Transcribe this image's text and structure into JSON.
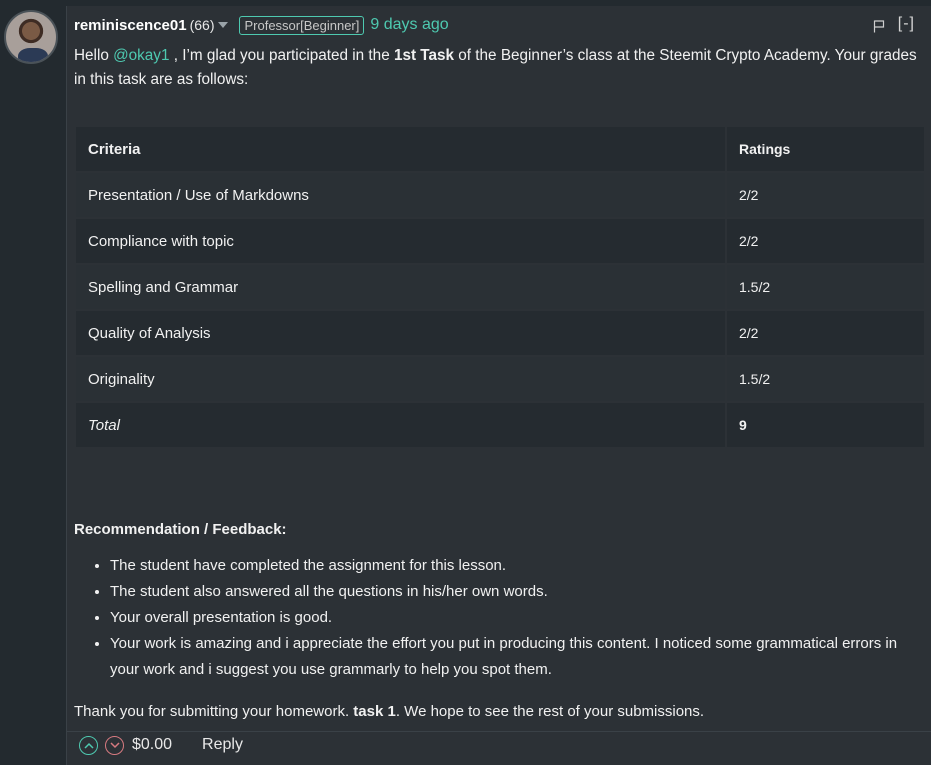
{
  "comment": {
    "author": "reminiscence01",
    "reputation": "(66)",
    "badge": "Professor[Beginner]",
    "timestamp": "9 days ago",
    "collapse_label": "[-]",
    "intro": {
      "part1": "Hello ",
      "mention": "@okay1",
      "part2": " , I’m glad you participated in the ",
      "bold1": "1st Task",
      "part3": " of the Beginner’s class at the Steemit Crypto Academy. Your grades in this task are as follows:"
    },
    "table": {
      "headers": [
        "Criteria",
        "Ratings"
      ],
      "rows": [
        {
          "criteria": "Presentation / Use of Markdowns",
          "rating": "2/2"
        },
        {
          "criteria": "Compliance with topic",
          "rating": "2/2"
        },
        {
          "criteria": "Spelling and Grammar",
          "rating": "1.5/2"
        },
        {
          "criteria": "Quality of Analysis",
          "rating": "2/2"
        },
        {
          "criteria": "Originality",
          "rating": "1.5/2"
        }
      ],
      "total_label": "Total",
      "total_value": "9"
    },
    "feedback_title": "Recommendation / Feedback:",
    "feedback_items": [
      "The student have completed the assignment for this lesson.",
      "The student also answered all the questions in his/her own words.",
      "Your overall presentation is good.",
      "Your work is amazing and i appreciate the effort you put in producing this content. I noticed some grammatical errors in your work and i suggest you use grammarly to help you spot them."
    ],
    "thanks": {
      "part1": "Thank you for submitting your homework. ",
      "bold": "task 1",
      "part2": ". We hope to see the rest of your submissions."
    },
    "footer": {
      "payout": "$0.00",
      "reply_label": "Reply"
    }
  },
  "colors": {
    "accent": "#4ec9b0",
    "downvote": "#d67a80",
    "background": "#232a2f",
    "panel": "#2c3136"
  }
}
